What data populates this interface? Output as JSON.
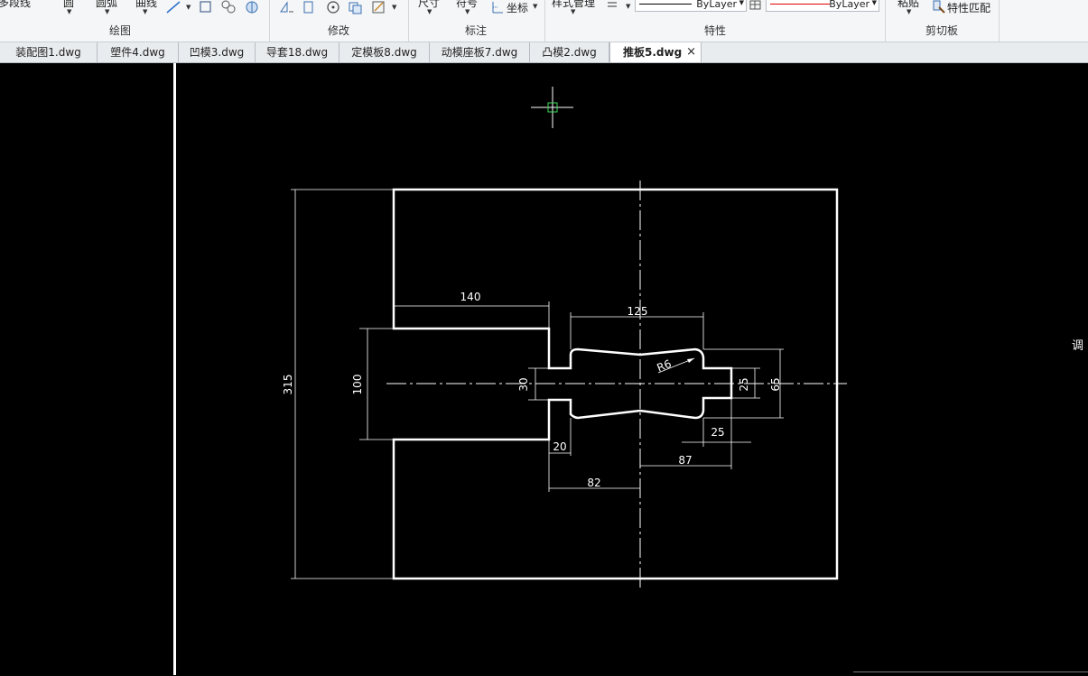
{
  "ribbon": {
    "draw_panel": {
      "title": "绘图",
      "tools": [
        "多段线",
        "圆",
        "圆弧",
        "曲线"
      ]
    },
    "modify_panel": {
      "title": "修改"
    },
    "annotate_panel": {
      "title": "标注",
      "tools": [
        "尺寸",
        "符号",
        "坐标"
      ]
    },
    "properties_panel": {
      "title": "特性",
      "style_manager": "样式管理",
      "linetype": "ByLayer",
      "color": "ByLayer",
      "color_swatch": "#e00000"
    },
    "clipboard_panel": {
      "title": "剪切板",
      "paste": "粘贴",
      "match_properties": "特性匹配"
    }
  },
  "tabs": [
    {
      "label": "装配图1.dwg",
      "active": false
    },
    {
      "label": "塑件4.dwg",
      "active": false
    },
    {
      "label": "凹模3.dwg",
      "active": false
    },
    {
      "label": "导套18.dwg",
      "active": false
    },
    {
      "label": "定模板8.dwg",
      "active": false
    },
    {
      "label": "动模座板7.dwg",
      "active": false
    },
    {
      "label": "凸模2.dwg",
      "active": false
    },
    {
      "label": "推板5.dwg",
      "active": true
    }
  ],
  "tab_close": "×",
  "drawing": {
    "dimensions": {
      "overall_height": "315",
      "left_width": "140",
      "slot_height": "100",
      "center_length": "125",
      "radius": "R6",
      "neck_height": "30",
      "right_height": "25",
      "outer_height": "65",
      "step_width": "20",
      "right_step": "25",
      "half_length": "87",
      "left_length": "82"
    }
  },
  "side_panel_text": "调"
}
